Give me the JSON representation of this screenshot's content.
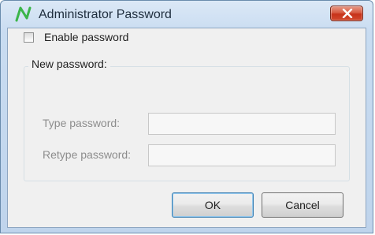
{
  "window": {
    "title": "Administrator Password",
    "app_icon": "green-n-logo",
    "close_icon": "close-x-icon"
  },
  "enable_password": {
    "label": "Enable password",
    "checked": false
  },
  "new_password_group": {
    "legend": "New password:",
    "type_label": "Type password:",
    "type_value": "",
    "retype_label": "Retype password:",
    "retype_value": ""
  },
  "buttons": {
    "ok_label": "OK",
    "cancel_label": "Cancel"
  },
  "colors": {
    "logo_green": "#3bb54a",
    "close_red": "#c7321a",
    "disabled_text": "#8d8d8d"
  }
}
